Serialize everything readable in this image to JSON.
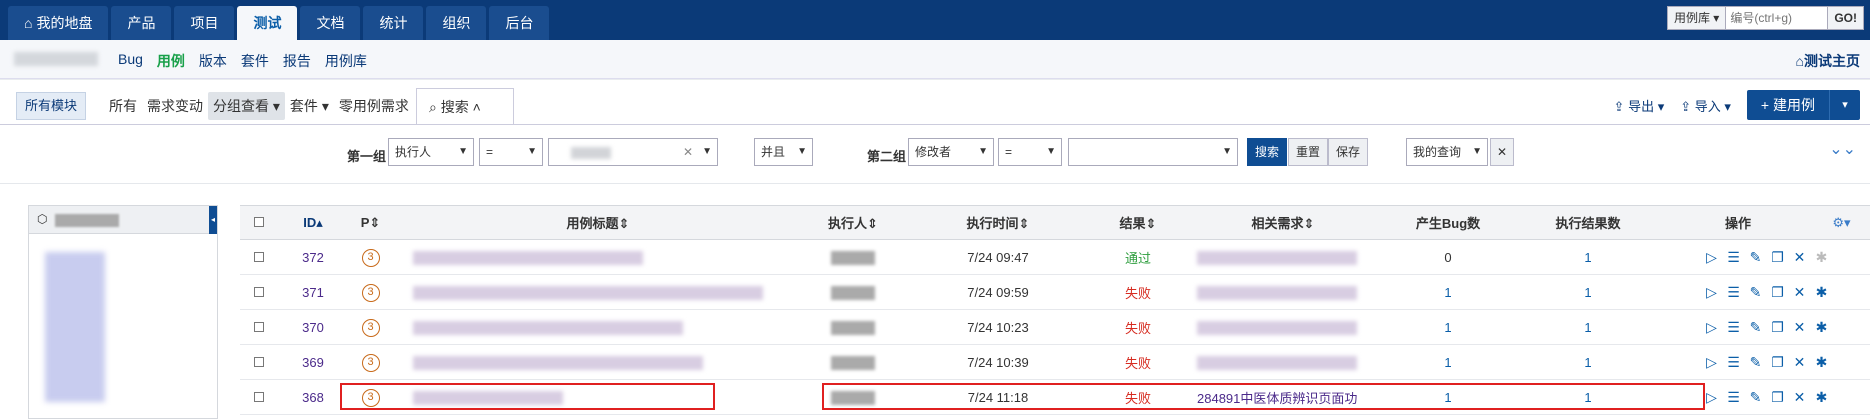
{
  "top_nav": {
    "tabs": [
      {
        "label": "我的地盘",
        "icon": "home-icon"
      },
      {
        "label": "产品"
      },
      {
        "label": "项目"
      },
      {
        "label": "测试",
        "active": true
      },
      {
        "label": "文档"
      },
      {
        "label": "统计"
      },
      {
        "label": "组织"
      },
      {
        "label": "后台"
      }
    ],
    "search_scope": "用例库",
    "search_placeholder": "编号(ctrl+g)",
    "go_label": "GO!"
  },
  "sub_nav": {
    "items": [
      {
        "label": "Bug"
      },
      {
        "label": "用例",
        "active": true
      },
      {
        "label": "版本"
      },
      {
        "label": "套件"
      },
      {
        "label": "报告"
      },
      {
        "label": "用例库"
      }
    ],
    "home_link": "测试主页"
  },
  "toolbar": {
    "all_modules": "所有模块",
    "filters": [
      "所有",
      "需求变动",
      "分组查看",
      "套件",
      "零用例需求"
    ],
    "search_tab": "搜索",
    "export": "导出",
    "import": "导入",
    "create": "+ 建用例"
  },
  "search_form": {
    "group1_label": "第一组",
    "group1_field": "执行人",
    "group1_op": "=",
    "logic": "并且",
    "group2_label": "第二组",
    "group2_field": "修改者",
    "group2_op": "=",
    "search_btn": "搜索",
    "reset_btn": "重置",
    "save_btn": "保存",
    "my_query": "我的查询"
  },
  "table": {
    "headers": [
      "ID",
      "P",
      "用例标题",
      "执行人",
      "执行时间",
      "结果",
      "相关需求",
      "产生Bug数",
      "执行结果数",
      "操作"
    ],
    "rows": [
      {
        "id": "372",
        "pri": "3",
        "time": "7/24 09:47",
        "result": "通过",
        "result_class": "pass",
        "story": "",
        "bugs": "0",
        "runs": "1"
      },
      {
        "id": "371",
        "pri": "3",
        "time": "7/24 09:59",
        "result": "失败",
        "result_class": "fail",
        "story": "",
        "bugs": "1",
        "runs": "1"
      },
      {
        "id": "370",
        "pri": "3",
        "time": "7/24 10:23",
        "result": "失败",
        "result_class": "fail",
        "story": "",
        "bugs": "1",
        "runs": "1"
      },
      {
        "id": "369",
        "pri": "3",
        "time": "7/24 10:39",
        "result": "失败",
        "result_class": "fail",
        "story": "",
        "bugs": "1",
        "runs": "1"
      },
      {
        "id": "368",
        "pri": "3",
        "time": "7/24 11:18",
        "result": "失败",
        "result_class": "fail",
        "story": "284891中医体质辨识页面功",
        "bugs": "1",
        "runs": "1"
      }
    ]
  },
  "colors": {
    "nav_bg": "#0b3a78",
    "accent": "#0f4d93",
    "pass": "#2e9e3e",
    "fail": "#d62b20",
    "highlight": "#e02020"
  }
}
